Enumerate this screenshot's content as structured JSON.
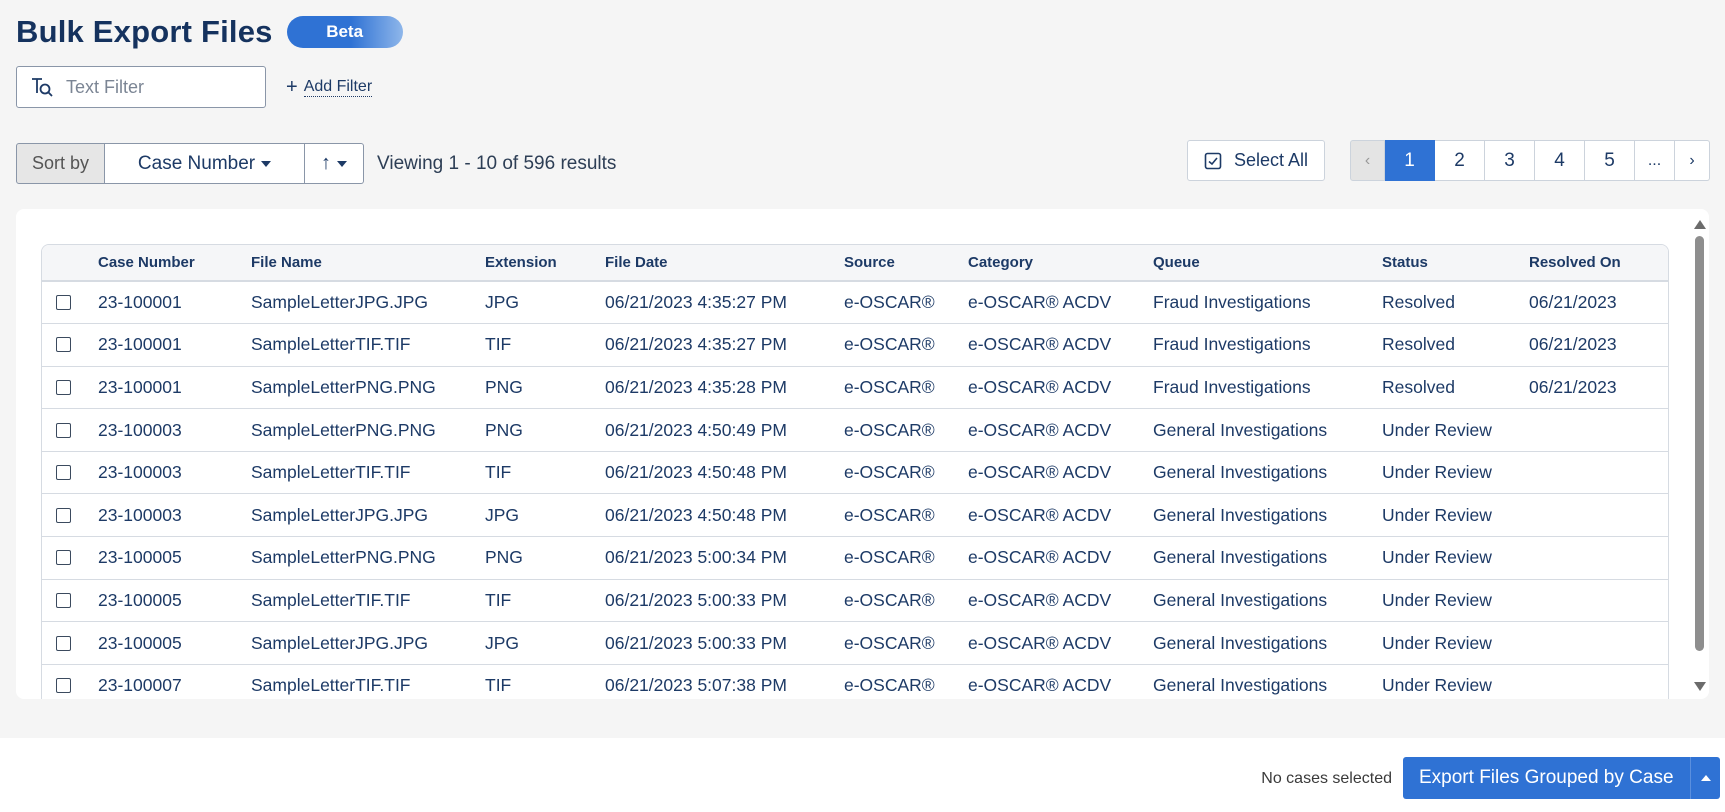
{
  "header": {
    "title": "Bulk Export Files",
    "badge": "Beta"
  },
  "filters": {
    "text_filter_placeholder": "Text Filter",
    "add_filter_label": "Add Filter"
  },
  "sort": {
    "label": "Sort by",
    "field": "Case Number",
    "direction_icon": "arrow-up-icon"
  },
  "results": {
    "viewing": "Viewing 1 - 10 of 596 results"
  },
  "select_all": {
    "label": "Select All"
  },
  "pagination": {
    "prev": "‹",
    "pages": [
      "1",
      "2",
      "3",
      "4",
      "5"
    ],
    "active": "1",
    "ellipsis": "...",
    "next": "›"
  },
  "table": {
    "columns": [
      "Case Number",
      "File Name",
      "Extension",
      "File Date",
      "Source",
      "Category",
      "Queue",
      "Status",
      "Resolved On"
    ],
    "rows": [
      [
        "23-100001",
        "SampleLetterJPG.JPG",
        "JPG",
        "06/21/2023 4:35:27 PM",
        "e-OSCAR®",
        "e-OSCAR® ACDV",
        "Fraud Investigations",
        "Resolved",
        "06/21/2023"
      ],
      [
        "23-100001",
        "SampleLetterTIF.TIF",
        "TIF",
        "06/21/2023 4:35:27 PM",
        "e-OSCAR®",
        "e-OSCAR® ACDV",
        "Fraud Investigations",
        "Resolved",
        "06/21/2023"
      ],
      [
        "23-100001",
        "SampleLetterPNG.PNG",
        "PNG",
        "06/21/2023 4:35:28 PM",
        "e-OSCAR®",
        "e-OSCAR® ACDV",
        "Fraud Investigations",
        "Resolved",
        "06/21/2023"
      ],
      [
        "23-100003",
        "SampleLetterPNG.PNG",
        "PNG",
        "06/21/2023 4:50:49 PM",
        "e-OSCAR®",
        "e-OSCAR® ACDV",
        "General Investigations",
        "Under Review",
        ""
      ],
      [
        "23-100003",
        "SampleLetterTIF.TIF",
        "TIF",
        "06/21/2023 4:50:48 PM",
        "e-OSCAR®",
        "e-OSCAR® ACDV",
        "General Investigations",
        "Under Review",
        ""
      ],
      [
        "23-100003",
        "SampleLetterJPG.JPG",
        "JPG",
        "06/21/2023 4:50:48 PM",
        "e-OSCAR®",
        "e-OSCAR® ACDV",
        "General Investigations",
        "Under Review",
        ""
      ],
      [
        "23-100005",
        "SampleLetterPNG.PNG",
        "PNG",
        "06/21/2023 5:00:34 PM",
        "e-OSCAR®",
        "e-OSCAR® ACDV",
        "General Investigations",
        "Under Review",
        ""
      ],
      [
        "23-100005",
        "SampleLetterTIF.TIF",
        "TIF",
        "06/21/2023 5:00:33 PM",
        "e-OSCAR®",
        "e-OSCAR® ACDV",
        "General Investigations",
        "Under Review",
        ""
      ],
      [
        "23-100005",
        "SampleLetterJPG.JPG",
        "JPG",
        "06/21/2023 5:00:33 PM",
        "e-OSCAR®",
        "e-OSCAR® ACDV",
        "General Investigations",
        "Under Review",
        ""
      ],
      [
        "23-100007",
        "SampleLetterTIF.TIF",
        "TIF",
        "06/21/2023 5:07:38 PM",
        "e-OSCAR®",
        "e-OSCAR® ACDV",
        "General Investigations",
        "Under Review",
        ""
      ]
    ]
  },
  "footer": {
    "selection_status": "No cases selected",
    "export_button": "Export Files Grouped by Case"
  },
  "colors": {
    "accent": "#2f72d4",
    "text": "#1d3a66",
    "background": "#f5f5f5"
  }
}
